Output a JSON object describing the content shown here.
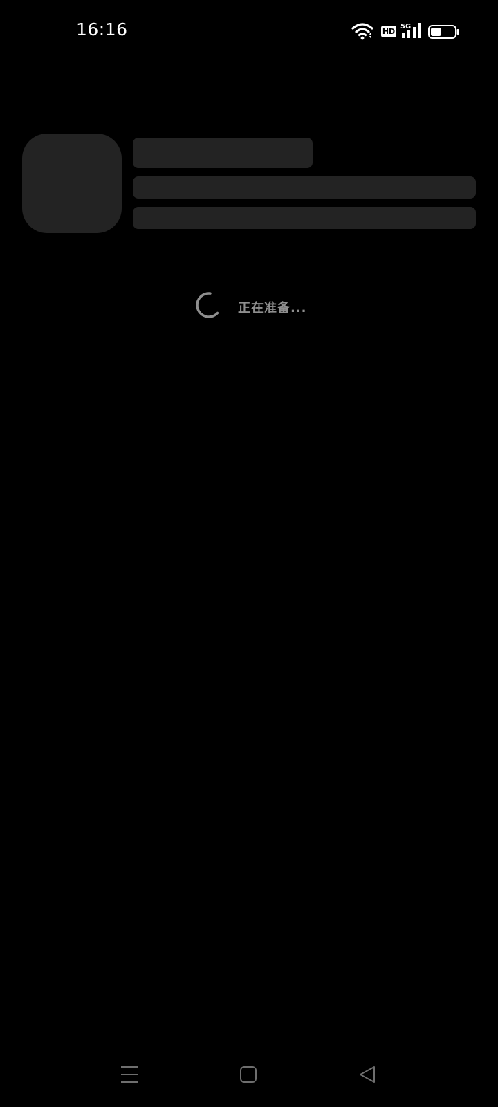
{
  "status_bar": {
    "time": "16:16",
    "network_badge": "HD",
    "network_type": "5G",
    "battery_level": 0.45
  },
  "loading": {
    "text": "正在准备..."
  },
  "navigation": {
    "icons": [
      "menu-icon",
      "home-icon",
      "back-icon"
    ]
  },
  "colors": {
    "background": "#000000",
    "skeleton": "#232323",
    "loading_text": "#8e8e8e",
    "nav_icon": "#6e6e6e"
  }
}
